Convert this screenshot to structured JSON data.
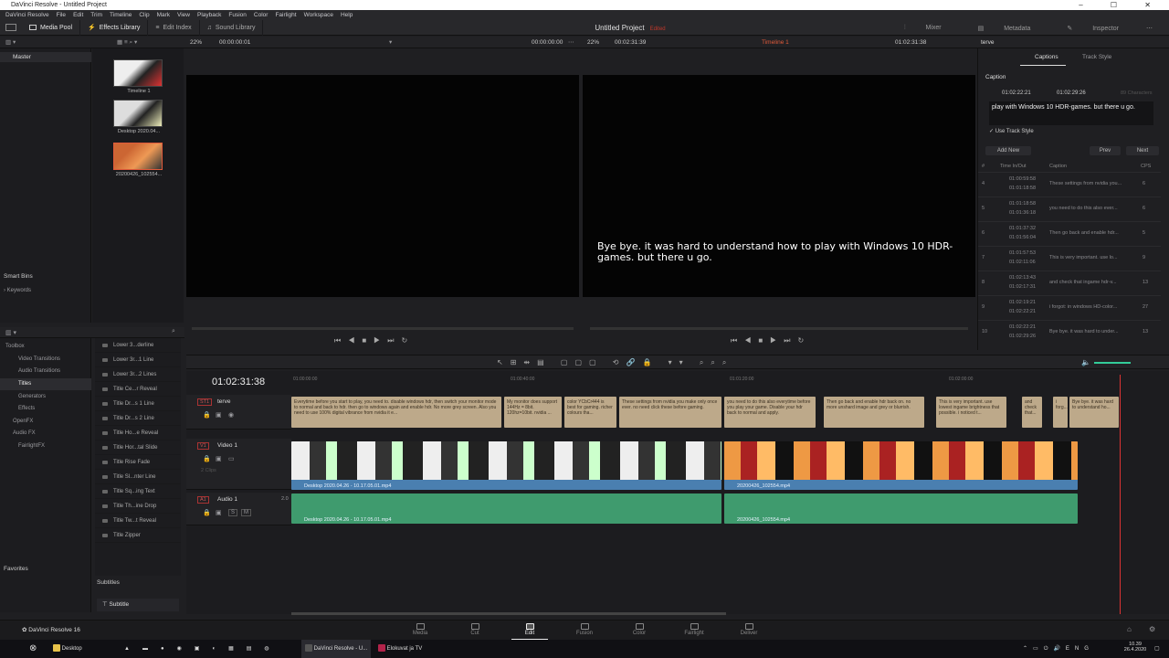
{
  "window": {
    "title": "DaVinci Resolve - Untitled Project"
  },
  "menu": [
    "DaVinci Resolve",
    "File",
    "Edit",
    "Trim",
    "Timeline",
    "Clip",
    "Mark",
    "View",
    "Playback",
    "Fusion",
    "Color",
    "Fairlight",
    "Workspace",
    "Help"
  ],
  "toolbar": {
    "media_pool": "Media Pool",
    "effects_library": "Effects Library",
    "edit_index": "Edit Index",
    "sound_library": "Sound Library",
    "project_title": "Untitled Project",
    "project_status": "Edited",
    "mixer": "Mixer",
    "metadata": "Metadata",
    "inspector": "Inspector"
  },
  "subbar": {
    "zoom_left": "22%",
    "tc_left": "00:00:00:01",
    "tc_src": "00:00:00:00",
    "zoom_right": "22%",
    "tc_right": "00:02:31:39",
    "timeline_name": "Timeline 1",
    "tc_timeline": "01:02:31:38",
    "inspector_target": "terve"
  },
  "media_pool": {
    "bin": "Master",
    "clips": [
      {
        "label": "Timeline 1"
      },
      {
        "label": "Desktop 2020.04..."
      },
      {
        "label": "20200426_102554..."
      }
    ],
    "smart_bins": "Smart Bins",
    "keywords": "Keywords"
  },
  "viewer": {
    "caption_text": "Bye bye. it was hard to understand how to play with Windows 10 HDR-games. but there u go."
  },
  "inspector": {
    "tab_captions": "Captions",
    "tab_track_style": "Track Style",
    "section": "Caption",
    "in_tc": "01:02:22:21",
    "out_tc": "01:02:29:26",
    "chars_label": "89 Characters",
    "edit_text": "play with Windows 10 HDR-games. but there u go.",
    "use_track_style": "Use Track Style",
    "add_new": "Add New",
    "prev": "Prev",
    "next": "Next",
    "col_num": "#",
    "col_time": "Time In/Out",
    "col_caption": "Caption",
    "col_cps": "CPS",
    "rows": [
      {
        "n": "4",
        "in": "01:00:59:58",
        "out": "01:01:18:58",
        "caption": "These settings from nvidia you...",
        "cps": "6"
      },
      {
        "n": "5",
        "in": "01:01:18:58",
        "out": "01:01:36:18",
        "caption": "you need to do this also ever...",
        "cps": "6"
      },
      {
        "n": "6",
        "in": "01:01:37:32",
        "out": "01:01:56:04",
        "caption": "Then go back and enable hdr...",
        "cps": "5"
      },
      {
        "n": "7",
        "in": "01:01:57:53",
        "out": "01:02:11:06",
        "caption": "This is very important. use lo...",
        "cps": "9"
      },
      {
        "n": "8",
        "in": "01:02:13:43",
        "out": "01:02:17:31",
        "caption": "and check that ingame hdr-v...",
        "cps": "13"
      },
      {
        "n": "9",
        "in": "01:02:19:21",
        "out": "01:02:22:21",
        "caption": "i forgot: in windows HD-color...",
        "cps": "27"
      },
      {
        "n": "10",
        "in": "01:02:22:21",
        "out": "01:02:29:26",
        "caption": "Bye bye. it was hard to under...",
        "cps": "13"
      }
    ]
  },
  "effects": {
    "tree": [
      "Toolbox",
      "Video Transitions",
      "Audio Transitions",
      "Titles",
      "Generators",
      "Effects",
      "OpenFX",
      "Audio FX",
      "FairlightFX"
    ],
    "items": [
      "Lower 3...derline",
      "Lower 3r...1 Line",
      "Lower 3r...2 Lines",
      "Title Ce...r Reveal",
      "Title Dr...s 1 Line",
      "Title Dr...s 2 Line",
      "Title Ho...e Reveal",
      "Title Hor...tal Slide",
      "Title Rise Fade",
      "Title Sl...nter Line",
      "Title Sq...ing Text",
      "Title Th...ine Drop",
      "Title Tw...t Reveal",
      "Title Zipper"
    ],
    "favorites": "Favorites",
    "subtitles": "Subtitles",
    "subtitle_item": "Subtitle"
  },
  "timeline": {
    "timecode": "01:02:31:38",
    "ruler": [
      "01:00:00:00",
      "01:00:40:00",
      "01:01:20:00",
      "01:02:00:00"
    ],
    "tracks": {
      "st1_id": "ST1",
      "st1_name": "terve",
      "v1_id": "V1",
      "v1_name": "Video 1",
      "v1_clips": "2 Clips",
      "a1_id": "A1",
      "a1_name": "Audio 1",
      "a1_ch": "2.0"
    },
    "subtitle_clips": [
      "Everytime before you start to play, you need to. disable windows hdr, then switch your monitor mode to normal and back to hdr. then go to windows again and enable hdr. No more grey screen. Also you need to use 100% digital vibrance from nvidia it e...",
      "My monitor does support 144Hz = 8bit. 120hz=10bit. nvidia ...",
      "color YCbCr444 is best for gaming. richer colours tha...",
      "These settings from nvidia you make only once ever. no need click these before gaming.",
      "you need to do this also everytime before you play your game. Disable your hdr back to normal and apply.",
      "Then go back and enable hdr back on. no more unshard image and grey or blurrish.",
      "This is very important. use lowest ingame brightness that possible. i noticed t...",
      "and check that...",
      "i forg...",
      "Bye bye. it was hard to understand ho..."
    ],
    "video_clip_1": "Desktop 2020.04.26 - 10.17.05.01.mp4",
    "video_clip_2": "20200426_102554.mp4",
    "audio_clip_1": "Desktop 2020.04.26 - 10.17.05.01.mp4",
    "audio_clip_2": "20200426_102554.mp4"
  },
  "pages": {
    "brand": "DaVinci Resolve 16",
    "tabs": [
      "Media",
      "Cut",
      "Edit",
      "Fusion",
      "Color",
      "Fairlight",
      "Deliver"
    ],
    "active": "Edit"
  },
  "taskbar": {
    "desktop": "Desktop",
    "resolve": "DaVinci Resolve - U...",
    "tv": "Elokuvat ja TV",
    "time": "10.39",
    "date": "26.4.2020"
  }
}
